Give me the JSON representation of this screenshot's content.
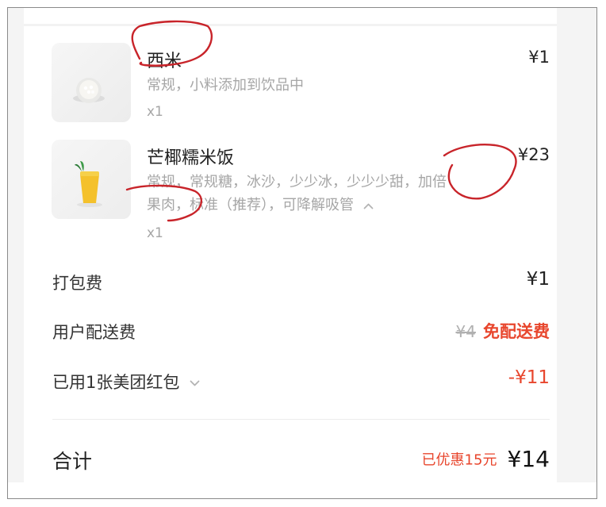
{
  "items": [
    {
      "name": "西米",
      "spec": "常规，小料添加到饮品中",
      "qty": "x1",
      "price": "¥1"
    },
    {
      "name": "芒椰糯米饭",
      "spec_line1": "常规，常规糖，冰沙，少少冰，少少少甜，加倍",
      "spec_line2": "果肉，标准（推荐），可降解吸管",
      "qty": "x1",
      "price": "¥23"
    }
  ],
  "fees": {
    "packing_label": "打包费",
    "packing_value": "¥1",
    "delivery_label": "用户配送费",
    "delivery_original": "¥4",
    "delivery_free": "免配送费",
    "coupon_label": "已用1张美团红包",
    "coupon_value": "-¥11"
  },
  "total": {
    "label": "合计",
    "discount": "已优惠15元",
    "amount": "¥14"
  },
  "colors": {
    "accent_red": "#e8462d",
    "annotation_ink": "#c8242a"
  },
  "icons": [
    "chevron-up-icon",
    "chevron-down-icon"
  ]
}
